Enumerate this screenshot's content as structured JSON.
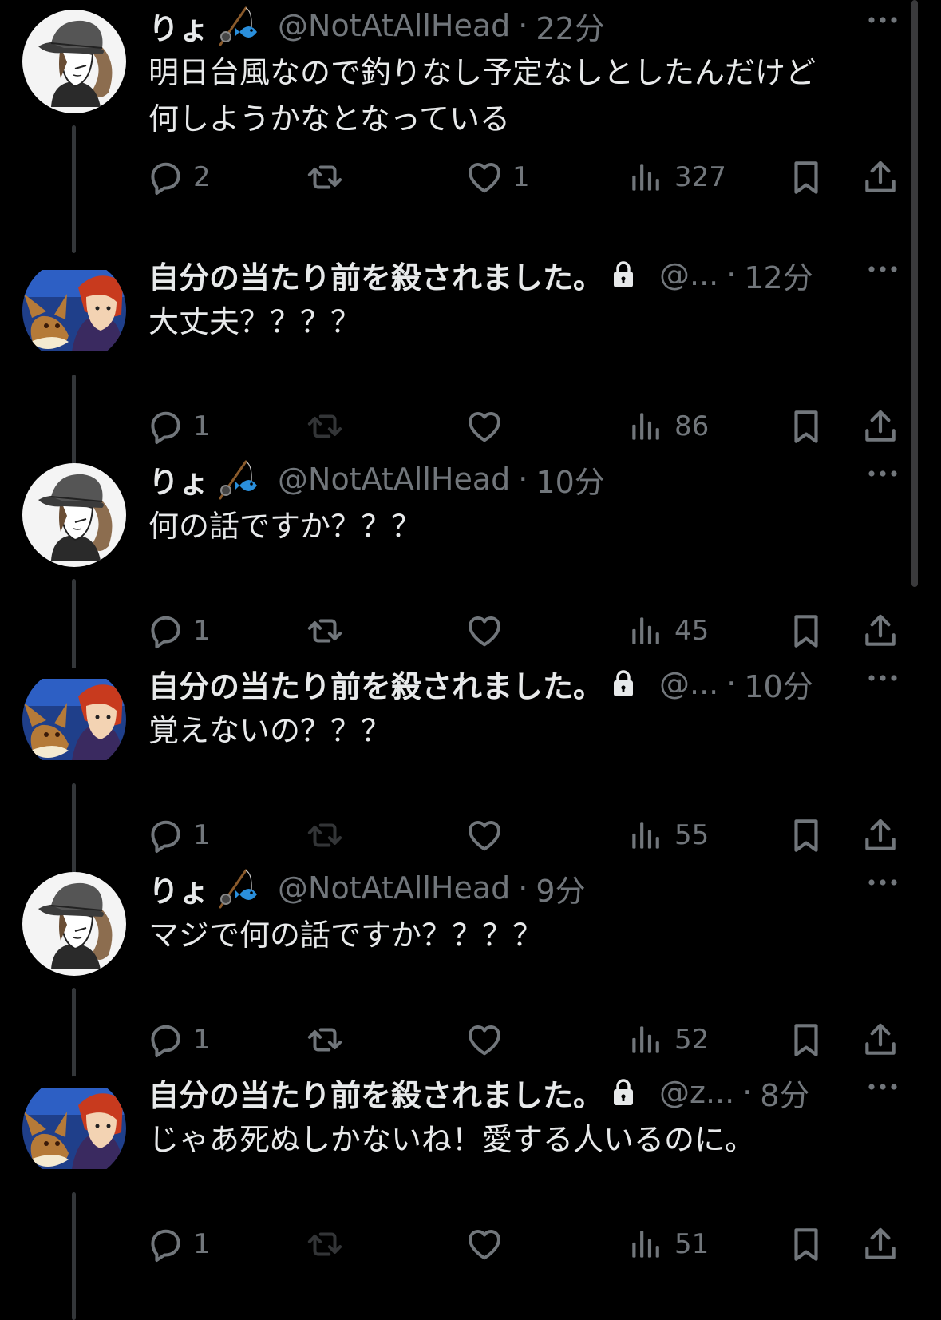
{
  "tweets": [
    {
      "name": "りょ",
      "handle": "@NotAtAllHead",
      "time": "22分",
      "text": "明日台風なので釣りなし予定なしとしたんだけど\n何しようかなとなっている",
      "reply": "2",
      "retweet": "",
      "like": "1",
      "views": "327",
      "avatar": "cap-avatar",
      "protected": false,
      "emoji": true
    },
    {
      "name": "自分の当たり前を殺されました。",
      "handle": "@...",
      "time": "12分",
      "text": "大丈夫？？？？",
      "reply": "1",
      "retweet": "",
      "like": "",
      "views": "86",
      "avatar": "anime-avatar",
      "protected": true,
      "emoji": false
    },
    {
      "name": "りょ",
      "handle": "@NotAtAllHead",
      "time": "10分",
      "text": "何の話ですか？？？",
      "reply": "1",
      "retweet": "",
      "like": "",
      "views": "45",
      "avatar": "cap-avatar",
      "protected": false,
      "emoji": true
    },
    {
      "name": "自分の当たり前を殺されました。",
      "handle": "@...",
      "time": "10分",
      "text": "覚えないの？？？",
      "reply": "1",
      "retweet": "",
      "like": "",
      "views": "55",
      "avatar": "anime-avatar",
      "protected": true,
      "emoji": false
    },
    {
      "name": "りょ",
      "handle": "@NotAtAllHead",
      "time": "9分",
      "text": "マジで何の話ですか？？？？",
      "reply": "1",
      "retweet": "",
      "like": "",
      "views": "52",
      "avatar": "cap-avatar",
      "protected": false,
      "emoji": true
    },
    {
      "name": "自分の当たり前を殺されました。",
      "handle": "@z...",
      "time": "8分",
      "text": "じゃあ死ぬしかないね！愛する人いるのに。",
      "reply": "1",
      "retweet": "",
      "like": "",
      "views": "51",
      "avatar": "anime-avatar",
      "protected": true,
      "emoji": false
    }
  ],
  "colors": {
    "background": "#000000",
    "text": "#e7e9ea",
    "muted": "#71767b",
    "thread_line": "#333639"
  },
  "icons": {
    "reply": "reply-icon",
    "retweet": "retweet-icon",
    "like": "heart-icon",
    "views": "views-icon",
    "bookmark": "bookmark-icon",
    "share": "share-icon",
    "more": "more-icon",
    "lock": "lock-icon",
    "emoji": "fishing-emoji"
  }
}
